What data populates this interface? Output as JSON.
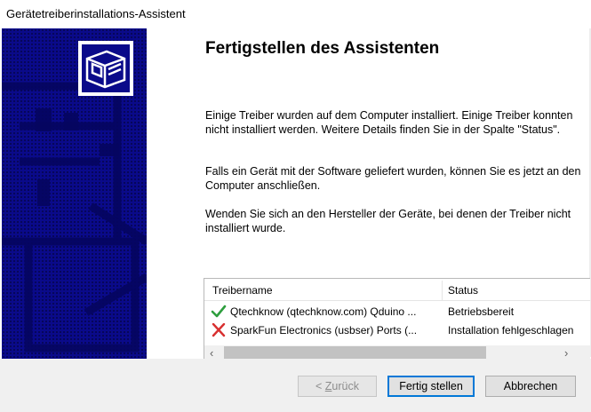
{
  "window": {
    "title": "Gerätetreiberinstallations-Assistent"
  },
  "sidebar": {
    "icon": "hardware-card-icon",
    "background_color": "#0a0a8a"
  },
  "main": {
    "heading": "Fertigstellen des Assistenten",
    "paragraph_1": "Einige Treiber wurden auf dem Computer installiert. Einige Treiber konnten nicht installiert werden. Weitere Details finden Sie in der Spalte \"Status\".",
    "paragraph_2": "Falls ein Gerät mit der Software geliefert wurden, können Sie es jetzt an den Computer anschließen.",
    "paragraph_3": "Wenden Sie sich an den Hersteller der Geräte, bei denen der Treiber nicht installiert wurde."
  },
  "driver_list": {
    "columns": [
      "Treibername",
      "Status"
    ],
    "rows": [
      {
        "icon": "checkmark-icon",
        "name": "Qtechknow (qtechknow.com) Qduino ...",
        "status": "Betriebsbereit"
      },
      {
        "icon": "error-x-icon",
        "name": "SparkFun Electronics (usbser) Ports (...",
        "status": "Installation fehlgeschlagen"
      }
    ],
    "scroll_left": "‹",
    "scroll_right": "›"
  },
  "buttons": {
    "back_prefix": "< ",
    "back_accel": "Z",
    "back_rest": "urück",
    "finish": "Fertig stellen",
    "cancel": "Abbrechen"
  },
  "colors": {
    "accent": "#0078d7",
    "success": "#2e9e3e",
    "error": "#d83030"
  }
}
